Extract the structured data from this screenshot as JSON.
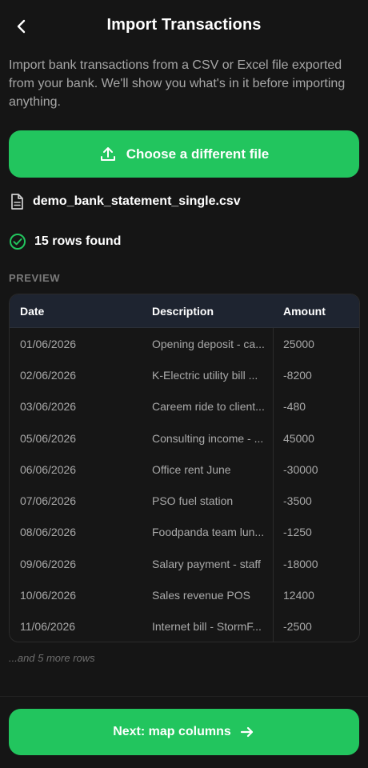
{
  "header": {
    "title": "Import Transactions",
    "back_icon": "chevron-left-icon"
  },
  "intro_text": "Import bank transactions from a CSV or Excel file exported from your bank. We'll show you what's in it before importing anything.",
  "choose_button": {
    "label": "Choose a different file",
    "icon": "upload-icon"
  },
  "file": {
    "name": "demo_bank_statement_single.csv",
    "icon": "file-icon"
  },
  "rows_found": {
    "label": "15 rows found",
    "icon": "check-circle-icon"
  },
  "preview": {
    "section_label": "PREVIEW",
    "columns": [
      "Date",
      "Description",
      "Amount"
    ],
    "rows": [
      {
        "date": "01/06/2026",
        "description": "Opening deposit - ca...",
        "amount": "25000"
      },
      {
        "date": "02/06/2026",
        "description": "K-Electric utility bill ...",
        "amount": "-8200"
      },
      {
        "date": "03/06/2026",
        "description": "Careem ride to client...",
        "amount": "-480"
      },
      {
        "date": "05/06/2026",
        "description": "Consulting income - ...",
        "amount": "45000"
      },
      {
        "date": "06/06/2026",
        "description": "Office rent June",
        "amount": "-30000"
      },
      {
        "date": "07/06/2026",
        "description": "PSO fuel station",
        "amount": "-3500"
      },
      {
        "date": "08/06/2026",
        "description": "Foodpanda team lun...",
        "amount": "-1250"
      },
      {
        "date": "09/06/2026",
        "description": "Salary payment - staff",
        "amount": "-18000"
      },
      {
        "date": "10/06/2026",
        "description": "Sales revenue POS",
        "amount": "12400"
      },
      {
        "date": "11/06/2026",
        "description": "Internet bill - StormF...",
        "amount": "-2500"
      }
    ],
    "more_text": "...and 5 more rows"
  },
  "next_button": {
    "label": "Next: map columns",
    "icon": "arrow-right-icon"
  },
  "colors": {
    "accent": "#22c55e",
    "background": "#151515",
    "table_header": "#1e2430"
  }
}
